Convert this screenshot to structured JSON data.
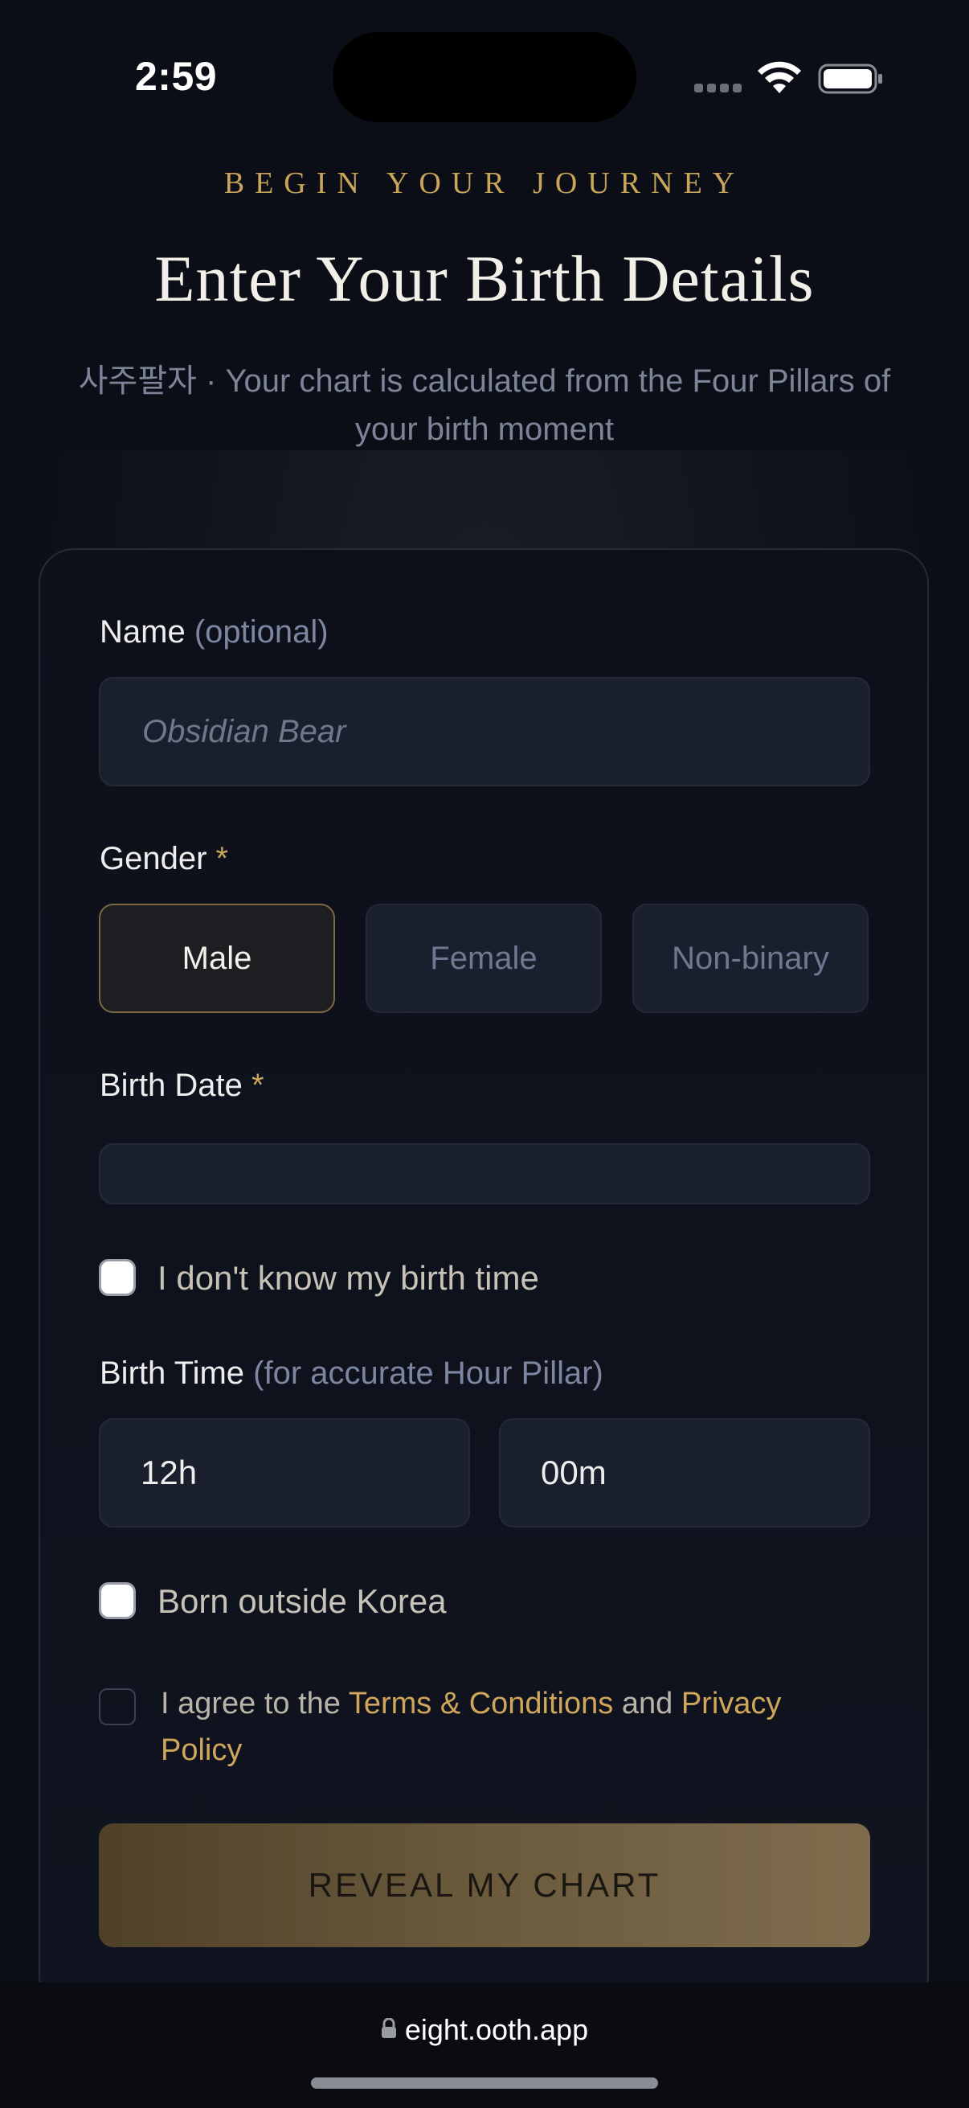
{
  "status_bar": {
    "time": "2:59"
  },
  "header": {
    "eyebrow": "BEGIN YOUR JOURNEY",
    "title": "Enter Your Birth Details",
    "subtitle": "사주팔자 · Your chart is calculated from the Four Pillars of your birth moment"
  },
  "form": {
    "name": {
      "label": "Name",
      "label_suffix": "(optional)",
      "placeholder": "Obsidian Bear",
      "value": ""
    },
    "gender": {
      "label": "Gender",
      "required_mark": "*",
      "options": [
        "Male",
        "Female",
        "Non-binary"
      ],
      "selected": "Male"
    },
    "birth_date": {
      "label": "Birth Date",
      "required_mark": "*",
      "value": ""
    },
    "unknown_time": {
      "label": "I don't know my birth time",
      "checked": false
    },
    "birth_time": {
      "label": "Birth Time",
      "label_suffix": "(for accurate Hour Pillar)",
      "hour": "12h",
      "minute": "00m"
    },
    "born_outside": {
      "label": "Born outside Korea",
      "checked": false
    },
    "agree": {
      "prefix": "I agree to the ",
      "terms_link": "Terms & Conditions",
      "middle": " and ",
      "privacy_link": "Privacy Policy",
      "checked": false
    },
    "submit_label": "REVEAL MY CHART"
  },
  "browser": {
    "url": "eight.ooth.app"
  },
  "colors": {
    "accent_gold": "#c9a55a",
    "background": "#0b0e16",
    "field_bg": "#1a1f2e"
  }
}
